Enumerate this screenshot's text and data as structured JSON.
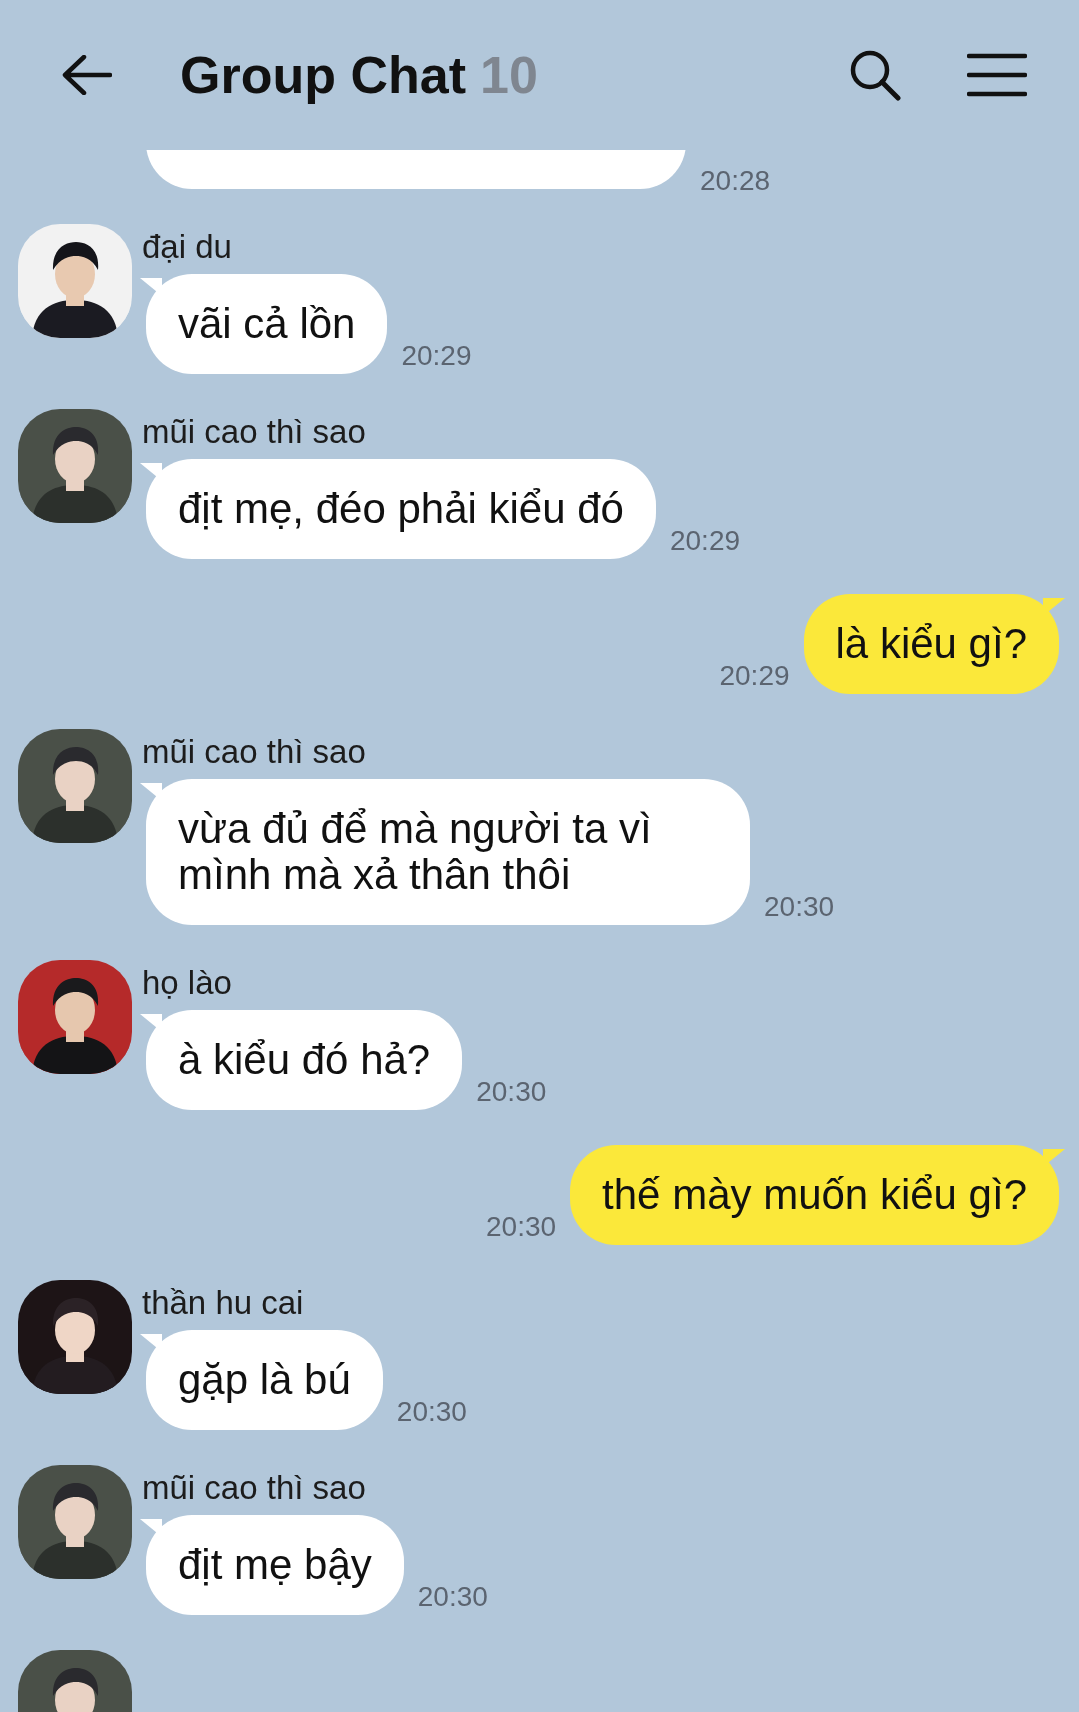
{
  "header": {
    "title": "Group Chat",
    "member_count": "10"
  },
  "messages": [
    {
      "kind": "clipped",
      "time": "20:28"
    },
    {
      "kind": "incoming",
      "sender": "đại du",
      "text": "vãi cả lồn",
      "time": "20:29"
    },
    {
      "kind": "incoming",
      "sender": "mũi cao thì sao",
      "text": "địt mẹ, đéo phải kiểu đó",
      "time": "20:29"
    },
    {
      "kind": "outgoing",
      "text": "là kiểu gì?",
      "time": "20:29"
    },
    {
      "kind": "incoming",
      "sender": "mũi cao thì sao",
      "text": "vừa đủ để mà người ta vì mình mà xả thân thôi",
      "time": "20:30"
    },
    {
      "kind": "incoming",
      "sender": "họ lào",
      "text": "à kiểu đó hả?",
      "time": "20:30"
    },
    {
      "kind": "outgoing",
      "text": "thế mày muốn kiểu gì?",
      "time": "20:30"
    },
    {
      "kind": "incoming",
      "sender": "thần hu cai",
      "text": "gặp là bú",
      "time": "20:30"
    },
    {
      "kind": "incoming",
      "sender": "mũi cao thì sao",
      "text": "địt mẹ bậy",
      "time": "20:30"
    },
    {
      "kind": "avatar_only"
    }
  ]
}
